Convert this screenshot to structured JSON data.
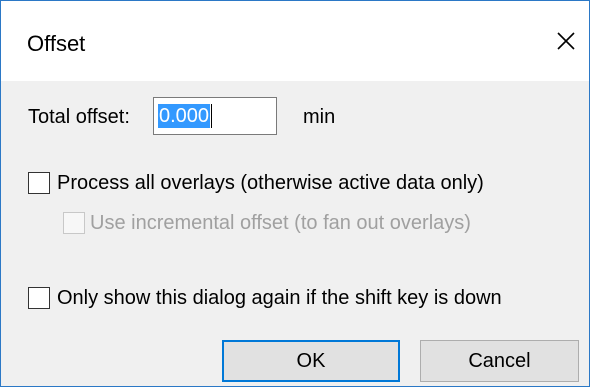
{
  "window": {
    "title": "Offset",
    "close_icon": "close-icon"
  },
  "offset": {
    "label": "Total offset:",
    "value": "0.000",
    "unit": "min"
  },
  "options": {
    "process_all": {
      "label": "Process all overlays (otherwise active data only)",
      "checked": false,
      "enabled": true
    },
    "incremental": {
      "label": "Use incremental offset (to fan out overlays)",
      "checked": false,
      "enabled": false
    },
    "shift_only": {
      "label": "Only show this dialog again if the shift key is down",
      "checked": false,
      "enabled": true
    }
  },
  "buttons": {
    "ok": "OK",
    "cancel": "Cancel"
  },
  "colors": {
    "accent": "#0078d7",
    "selection": "#3399ff",
    "dialog_bg": "#f0f0f0",
    "disabled_text": "#a0a0a0"
  }
}
